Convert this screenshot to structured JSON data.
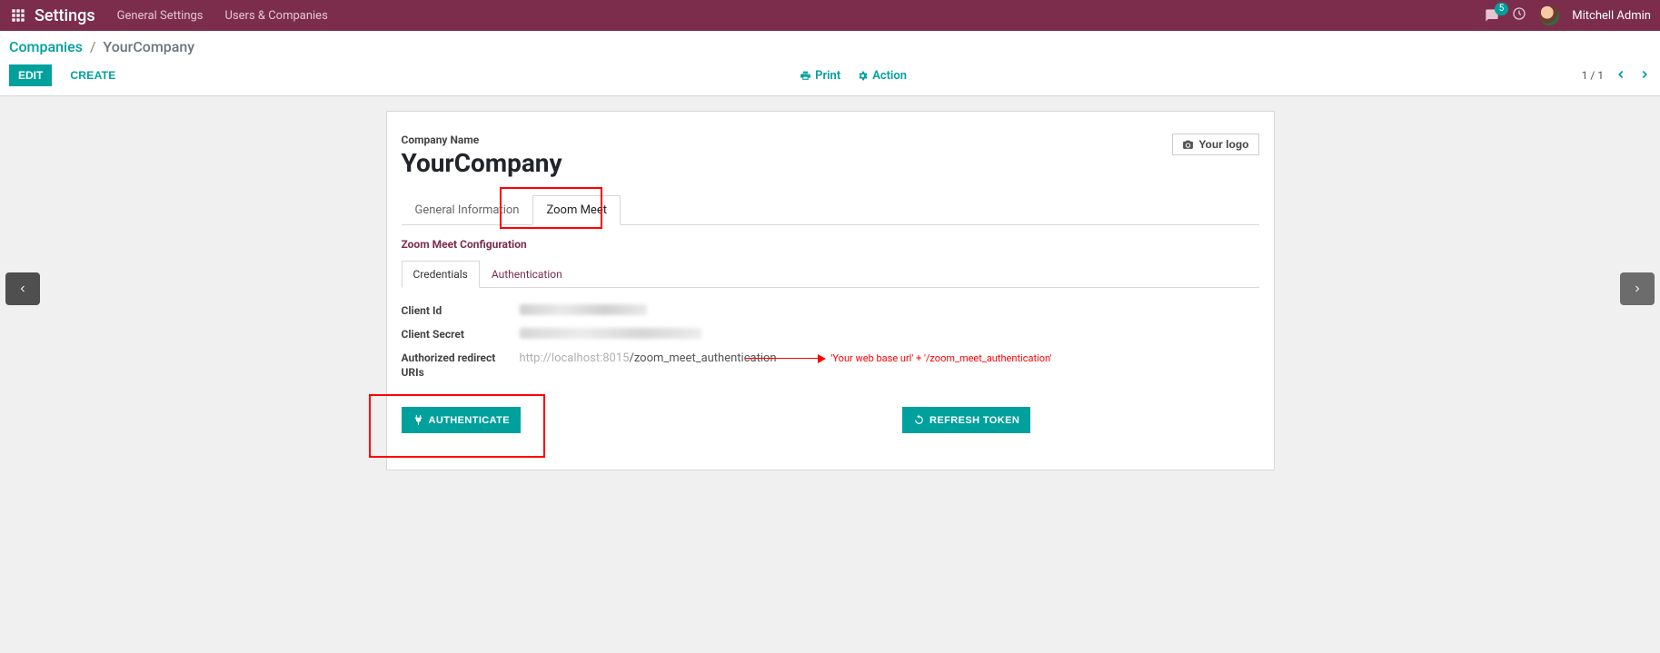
{
  "topbar": {
    "brand": "Settings",
    "nav": {
      "general": "General Settings",
      "users": "Users & Companies"
    },
    "badge_count": "5",
    "user_name": "Mitchell Admin"
  },
  "breadcrumb": {
    "root": "Companies",
    "current": "YourCompany"
  },
  "controls": {
    "edit": "EDIT",
    "create": "CREATE",
    "print": "Print",
    "action": "Action",
    "pager": "1 / 1"
  },
  "sheet": {
    "company_label": "Company Name",
    "company_name": "YourCompany",
    "logo_button": "Your logo",
    "tabs": {
      "general": "General Information",
      "zoom": "Zoom Meet"
    },
    "section": "Zoom Meet Configuration",
    "subtabs": {
      "credentials": "Credentials",
      "auth": "Authentication"
    },
    "fields": {
      "client_id_label": "Client Id",
      "client_secret_label": "Client Secret",
      "redirect_label": "Authorized redirect URIs",
      "redirect_value_prefix": "http://localhost:8015",
      "redirect_value_suffix": "/zoom_meet_authentication"
    },
    "annotation": "'Your web base url' + '/zoom_meet_authentication'",
    "buttons": {
      "authenticate": "AUTHENTICATE",
      "refresh": "REFRESH TOKEN"
    }
  }
}
